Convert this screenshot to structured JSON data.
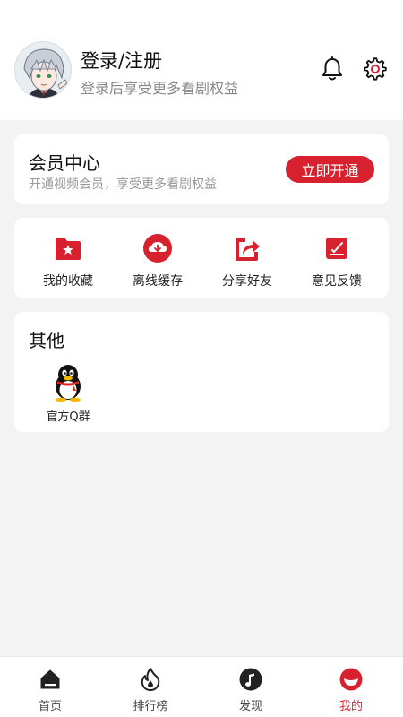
{
  "colors": {
    "accent": "#d8212f",
    "background": "#f3f3f3",
    "card": "#ffffff"
  },
  "header": {
    "avatar_icon": "anime-avatar",
    "title": "登录/注册",
    "subtitle": "登录后享受更多看剧权益",
    "bell_icon": "bell-icon",
    "settings_icon": "gear-icon"
  },
  "vip": {
    "title": "会员中心",
    "subtitle": "开通视频会员，享受更多看剧权益",
    "button": "立即开通"
  },
  "functions": [
    {
      "label": "我的收藏",
      "icon": "folder-star-icon"
    },
    {
      "label": "离线缓存",
      "icon": "cloud-download-icon"
    },
    {
      "label": "分享好友",
      "icon": "share-icon"
    },
    {
      "label": "意见反馈",
      "icon": "feedback-icon"
    }
  ],
  "other": {
    "title": "其他",
    "items": [
      {
        "label": "官方Q群",
        "icon": "qq-penguin-icon"
      }
    ]
  },
  "tabbar": {
    "active": "我的",
    "tabs": [
      {
        "label": "首页",
        "icon": "home-icon"
      },
      {
        "label": "排行榜",
        "icon": "flame-icon"
      },
      {
        "label": "发现",
        "icon": "music-note-icon"
      },
      {
        "label": "我的",
        "icon": "profile-icon"
      }
    ]
  }
}
